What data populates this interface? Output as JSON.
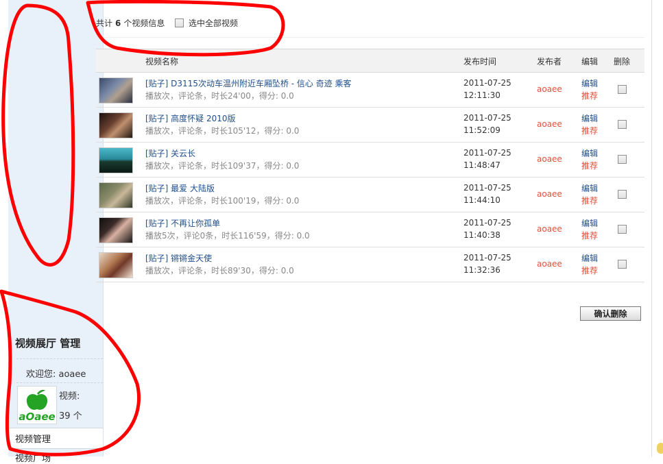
{
  "sidebar": {
    "title": "视频展厅  管理",
    "welcome": "欢迎您: aoaee",
    "video_label": "视频:",
    "video_count": "39 个",
    "menu_item": "视频管理",
    "menu_item_2": "视频广场",
    "avatar_text": "aOaee"
  },
  "header": {
    "count_prefix": "共计",
    "count_value": "6",
    "count_suffix": "个视频信息",
    "select_all_label": "选中全部视频"
  },
  "table": {
    "columns": {
      "name": "视频名称",
      "time": "发布时间",
      "author": "发布者",
      "edit": "编辑",
      "delete": "删除"
    },
    "rows": [
      {
        "title": "[贴子] D3115次动车温州附近车厢坠桥 - 信心  奇迹  乘客",
        "meta": "播放次，评论条，时长24'00，得分: 0.0",
        "date": "2011-07-25",
        "time": "12:11:30",
        "author": "aoaee",
        "edit": "编辑",
        "recommend": "推荐"
      },
      {
        "title": "[贴子] 高度怀疑  2010版",
        "meta": "播放次，评论条，时长105'12，得分: 0.0",
        "date": "2011-07-25",
        "time": "11:52:09",
        "author": "aoaee",
        "edit": "编辑",
        "recommend": "推荐"
      },
      {
        "title": "[贴子] 关云长",
        "meta": "播放次，评论条，时长109'37，得分: 0.0",
        "date": "2011-07-25",
        "time": "11:48:47",
        "author": "aoaee",
        "edit": "编辑",
        "recommend": "推荐"
      },
      {
        "title": "[贴子] 最爱  大陆版",
        "meta": "播放次，评论条，时长100'19，得分: 0.0",
        "date": "2011-07-25",
        "time": "11:44:10",
        "author": "aoaee",
        "edit": "编辑",
        "recommend": "推荐"
      },
      {
        "title": "[贴子] 不再让你孤单",
        "meta": "播放5次，评论0条，时长116'59，得分: 0.0",
        "date": "2011-07-25",
        "time": "11:40:38",
        "author": "aoaee",
        "edit": "编辑",
        "recommend": "推荐"
      },
      {
        "title": "[贴子] 锵锵金天使",
        "meta": "播放次，评论条，时长89'30，得分: 0.0",
        "date": "2011-07-25",
        "time": "11:32:36",
        "author": "aoaee",
        "edit": "编辑",
        "recommend": "推荐"
      }
    ]
  },
  "confirm_delete_label": "确认删除",
  "colors": {
    "link": "#1f4e8c",
    "author": "#e0523a",
    "sidebar_bg": "#e8f0f9",
    "annotation": "#ff0000"
  }
}
